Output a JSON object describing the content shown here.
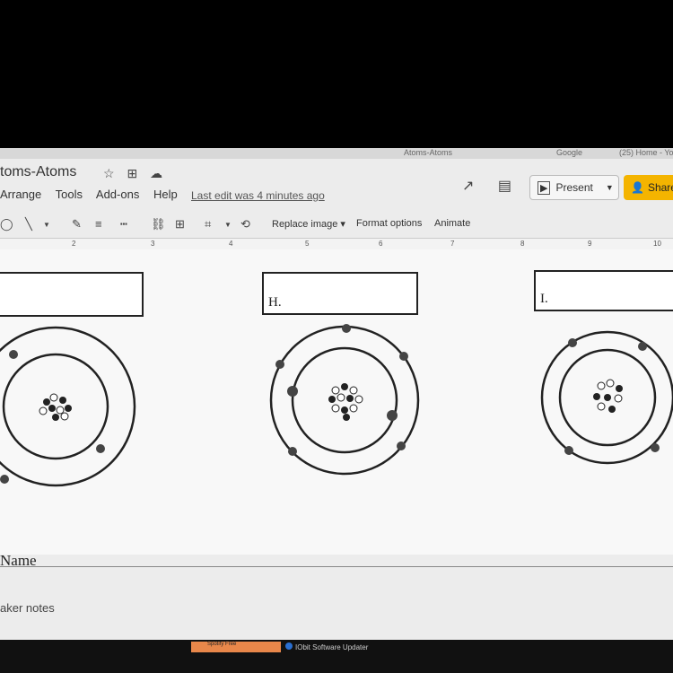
{
  "browser_tabs": [
    "Atoms-Atoms",
    "Google",
    "(25) Home - Yo"
  ],
  "doc": {
    "title": "toms-Atoms",
    "last_edit": "Last edit was 4 minutes ago"
  },
  "menu": [
    "Arrange",
    "Tools",
    "Add-ons",
    "Help"
  ],
  "buttons": {
    "present": "Present",
    "share": "Share"
  },
  "toolbar": {
    "replace_image": "Replace image ▾",
    "format_options": "Format options",
    "animate": "Animate"
  },
  "ruler": [
    "2",
    "3",
    "4",
    "5",
    "6",
    "7",
    "8",
    "9",
    "10"
  ],
  "slide": {
    "labels": [
      "",
      "H.",
      "I."
    ],
    "name_label": "Name"
  },
  "speaker_notes": "aker notes",
  "taskbar": {
    "item1": "Spotify Free",
    "item2": "IObit Software Updater"
  }
}
